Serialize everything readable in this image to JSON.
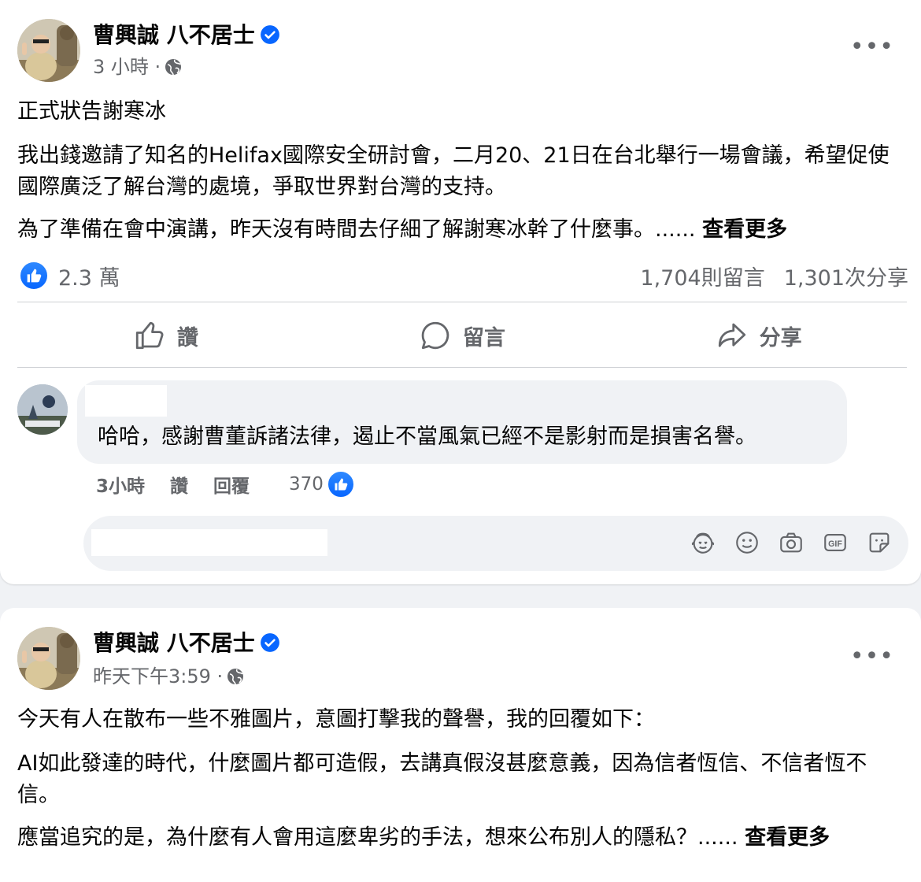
{
  "post1": {
    "author": "曹興誠 八不居士",
    "time": "3 小時 ·",
    "more": "•••",
    "paragraphs": [
      "正式狀告謝寒冰",
      "我出錢邀請了知名的Helifax國際安全研討會，二月20、21日在台北舉行一場會議，希望促使國際廣泛了解台灣的處境，爭取世界對台灣的支持。",
      "為了準備在會中演講，昨天沒有時間去仔細了解謝寒冰幹了什麼事。......"
    ],
    "see_more": "查看更多",
    "reactions": "2.3 萬",
    "comments_count": "1,704則留言",
    "shares_count": "1,301次分享",
    "actions": {
      "like": "讚",
      "comment": "留言",
      "share": "分享"
    },
    "comment": {
      "text": "哈哈，感謝曹董訴諸法律，遏止不當風氣已經不是影射而是損害名譽。",
      "time": "3小時",
      "like": "讚",
      "reply": "回覆",
      "likes": "370"
    },
    "composer_icons": [
      "avatar-sticker-icon",
      "emoji-icon",
      "camera-icon",
      "gif-icon",
      "sticker-icon"
    ],
    "colors": {
      "accent": "#0866ff",
      "secondary_text": "#65676b",
      "bubble": "#f0f2f5"
    }
  },
  "post2": {
    "author": "曹興誠 八不居士",
    "time": "昨天下午3:59 ·",
    "more": "•••",
    "paragraphs": [
      "今天有人在散布一些不雅圖片，意圖打擊我的聲譽，我的回覆如下：",
      "AI如此發達的時代，什麼圖片都可造假，去講真假沒甚麼意義，因為信者恆信、不信者恆不信。",
      "應當追究的是，為什麼有人會用這麼卑劣的手法，想來公布別人的隱私？......"
    ],
    "see_more": "查看更多"
  }
}
